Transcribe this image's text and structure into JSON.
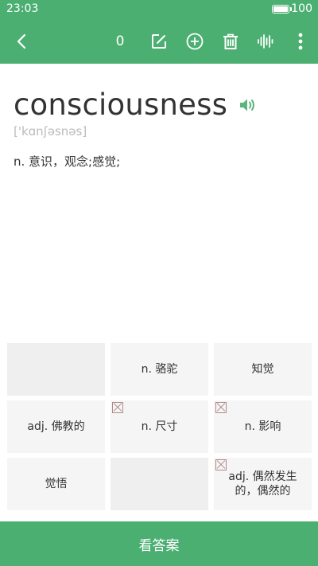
{
  "status_bar": {
    "time": "23:03",
    "battery": "100"
  },
  "toolbar": {
    "count": "0"
  },
  "word": {
    "text": "consciousness",
    "phonetic": "['kɑnʃəsnəs]",
    "definition": "n.  意识，观念;感觉;"
  },
  "choices": [
    {
      "label": "",
      "wrong": false
    },
    {
      "label": "n.  骆驼",
      "wrong": false
    },
    {
      "label": "知觉",
      "wrong": false
    },
    {
      "label": "adj.  佛教的",
      "wrong": false
    },
    {
      "label": "n.  尺寸",
      "wrong": true
    },
    {
      "label": "n.  影响",
      "wrong": true
    },
    {
      "label": "觉悟",
      "wrong": false
    },
    {
      "label": "",
      "wrong": false
    },
    {
      "label": "adj.  偶然发生的，偶然的",
      "wrong": true
    }
  ],
  "answer_button": {
    "label": "看答案"
  },
  "colors": {
    "accent": "#4caf72",
    "cell": "#f5f5f5",
    "wrong_mark": "#b08a8a"
  }
}
